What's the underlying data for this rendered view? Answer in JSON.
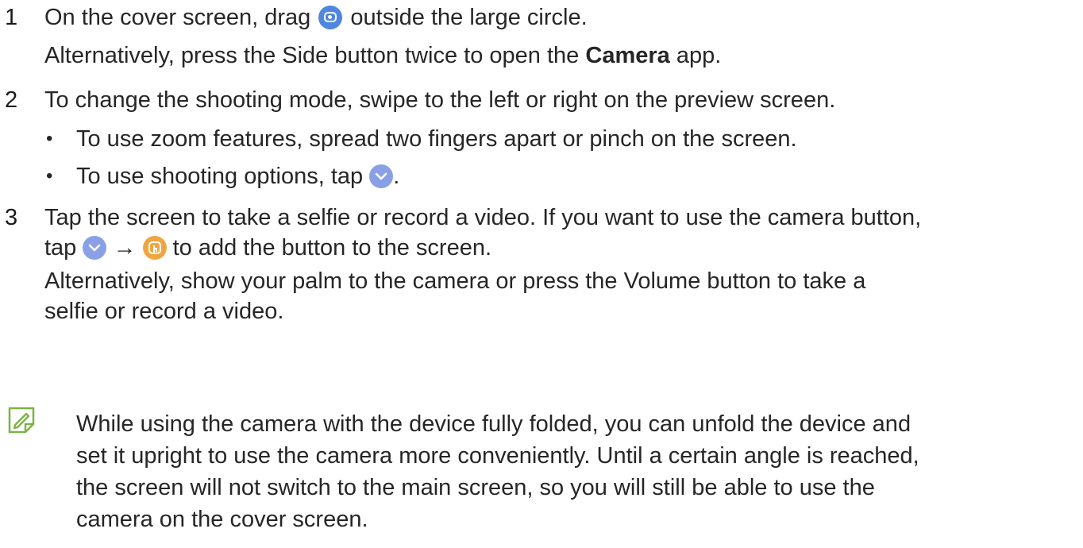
{
  "steps": [
    {
      "number": "1",
      "text_before_icon": "On the cover screen, drag",
      "text_after_icon": "outside the large circle.",
      "alt_before_bold": "Alternatively, press the Side button twice to open the",
      "alt_bold": "Camera",
      "alt_after_bold": "app."
    },
    {
      "number": "2",
      "text": "To change the shooting mode, swipe to the left or right on the preview screen.",
      "bullets": [
        {
          "text": "To use zoom features, spread two fingers apart or pinch on the screen."
        },
        {
          "text_before_icon": "To use shooting options, tap",
          "text_after_icon": "."
        }
      ]
    },
    {
      "number": "3",
      "line1": "Tap the screen to take a selfie or record a video. If you want to use the camera button,",
      "line2_prefix": "tap",
      "arrow": "→",
      "line2_suffix": "to add the button to the screen.",
      "alt_line1": "Alternatively, show your palm to the camera or press the Volume button to take a",
      "alt_line2": "selfie or record a video."
    }
  ],
  "note": {
    "icon": "note-pencil-icon",
    "lines": [
      "While using the camera with the device fully folded, you can unfold the device and",
      "set it upright to use the camera more conveniently. Until a certain angle is reached,",
      "the screen will not switch to the main screen, so you will still be able to use the",
      "camera on the cover screen."
    ]
  },
  "icons": {
    "camera": "camera-app-icon",
    "options": "chevron-down-circle-icon",
    "camera_button": "touch-button-icon"
  },
  "colors": {
    "text": "#262626",
    "camera_icon": "#4e86e0",
    "options_icon": "#8aa0e6",
    "button_icon": "#f0a640",
    "note_icon": "#7cb342"
  }
}
